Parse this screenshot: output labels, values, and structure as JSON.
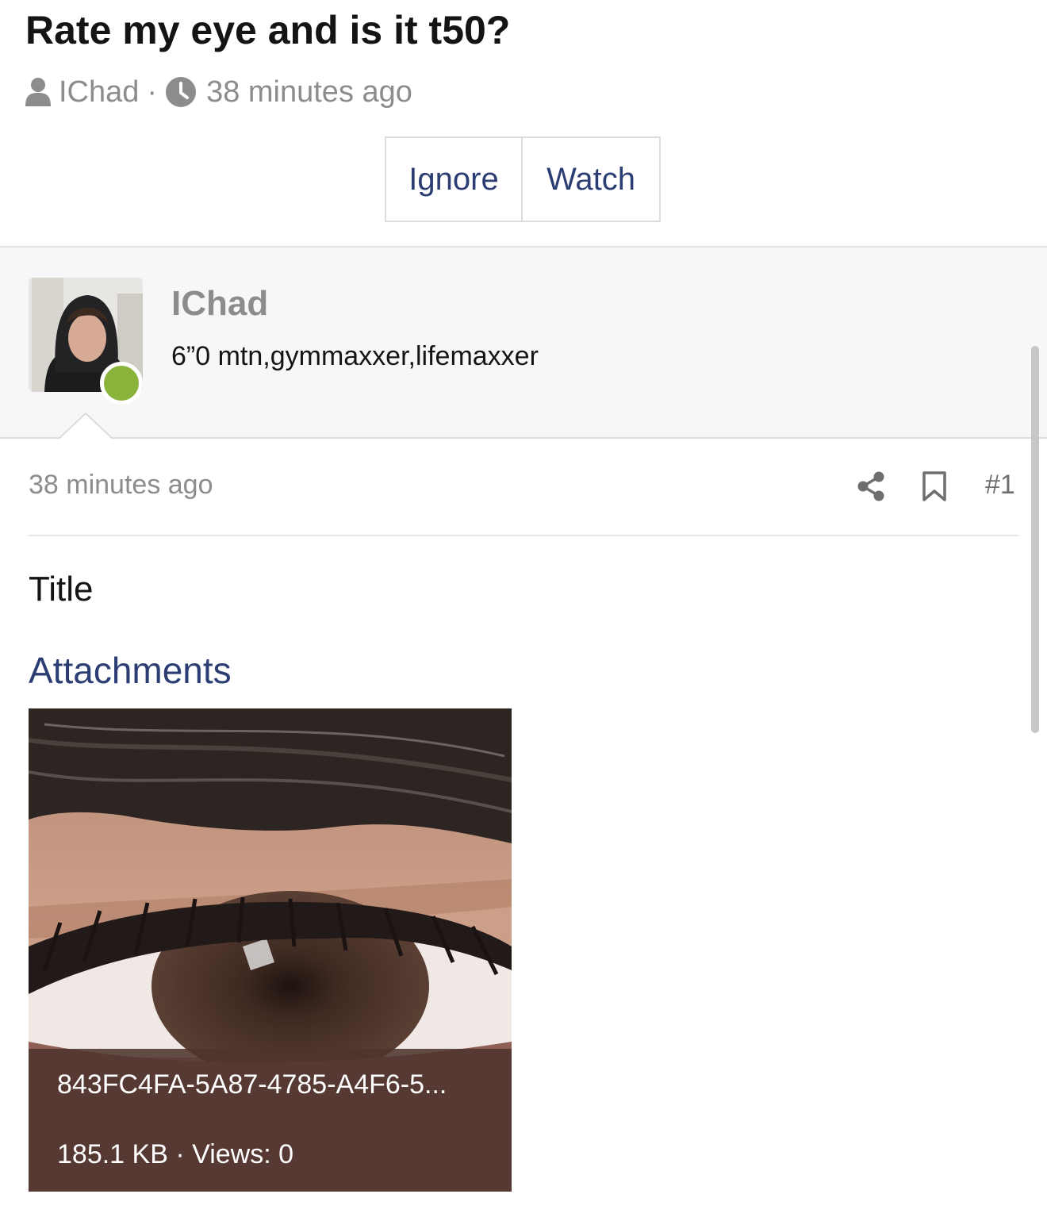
{
  "thread": {
    "title": "Rate my eye and is it t50?",
    "author": "IChad",
    "separator": "·",
    "time": "38 minutes ago"
  },
  "actions": {
    "ignore_label": "Ignore",
    "watch_label": "Watch"
  },
  "user": {
    "name": "IChad",
    "title": "6”0 mtn,gymmaxxer,lifemaxxer",
    "status": "online"
  },
  "message": {
    "date": "38 minutes ago",
    "number": "#1",
    "body": "Title",
    "attachments_heading": "Attachments"
  },
  "attachment": {
    "filename": "843FC4FA-5A87-4785-A4F6-5...",
    "size": "185.1 KB",
    "views": "Views: 0"
  },
  "colors": {
    "link": "#2b3d73",
    "muted": "#8c8c8c",
    "online": "#8ab33c"
  },
  "icons": [
    "user-icon",
    "clock-icon",
    "share-icon",
    "bookmark-icon"
  ]
}
